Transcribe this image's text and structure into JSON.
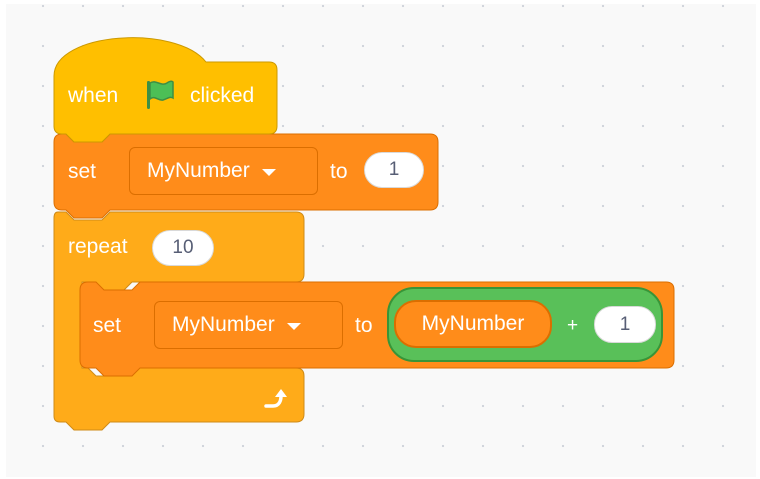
{
  "hat_block": {
    "when": "when",
    "flag_icon": "green-flag",
    "clicked": "clicked"
  },
  "set_block_1": {
    "set": "set",
    "variable": "MyNumber",
    "to": "to",
    "value": "1"
  },
  "repeat_block": {
    "repeat": "repeat",
    "times": "10",
    "loop_icon": "loop-arrow"
  },
  "set_block_2": {
    "set": "set",
    "variable": "MyNumber",
    "to": "to",
    "operator": {
      "left_reporter": "MyNumber",
      "symbol": "+",
      "right_value": "1"
    }
  },
  "colors": {
    "events": "#ffbf00",
    "events_border": "#cc9900",
    "control": "#ffab19",
    "control_border": "#cf8b17",
    "variables": "#ff8c1a",
    "variables_border": "#db6e00",
    "operators": "#59c059",
    "operators_border": "#389438",
    "flag": "#4cbf56"
  }
}
